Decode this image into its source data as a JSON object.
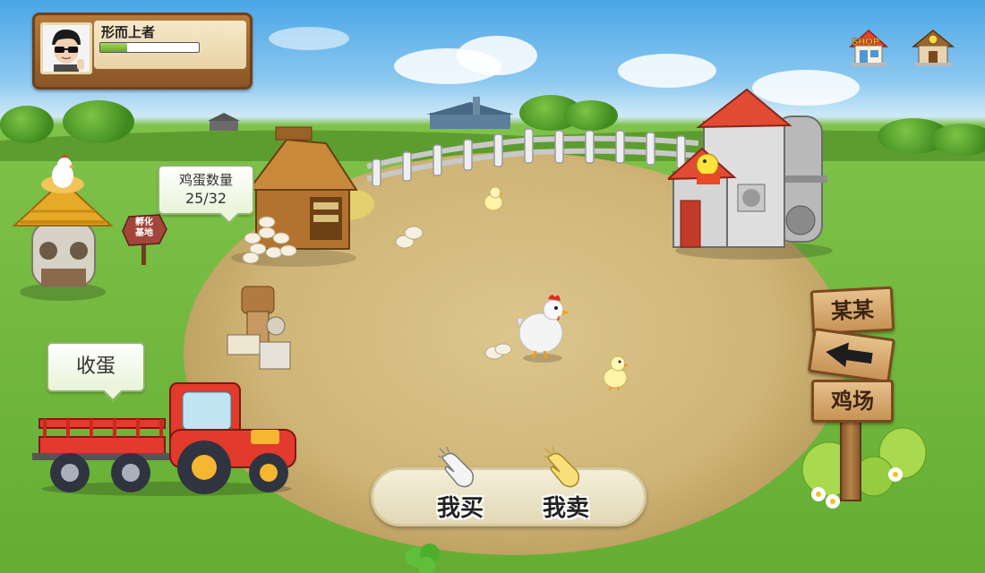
{
  "player": {
    "name": "形而上者",
    "xp_fraction": 0.27
  },
  "top_icons": {
    "shop_label": "SHOP"
  },
  "egg_counter": {
    "label": "鸡蛋数量",
    "value": "25/32"
  },
  "incubator_sign": {
    "line1": "孵化",
    "line2": "基地"
  },
  "collect_eggs": {
    "label": "收蛋"
  },
  "signpost": {
    "top_label": "某某",
    "bottom_label": "鸡场"
  },
  "trade": {
    "buy_label": "我买",
    "sell_label": "我卖"
  },
  "building_sign": {
    "label": "商店"
  },
  "colors": {
    "grass": "#64ad32",
    "dirt": "#cfb577",
    "wood": "#b57a3a",
    "tractor_red": "#e23a2c"
  }
}
